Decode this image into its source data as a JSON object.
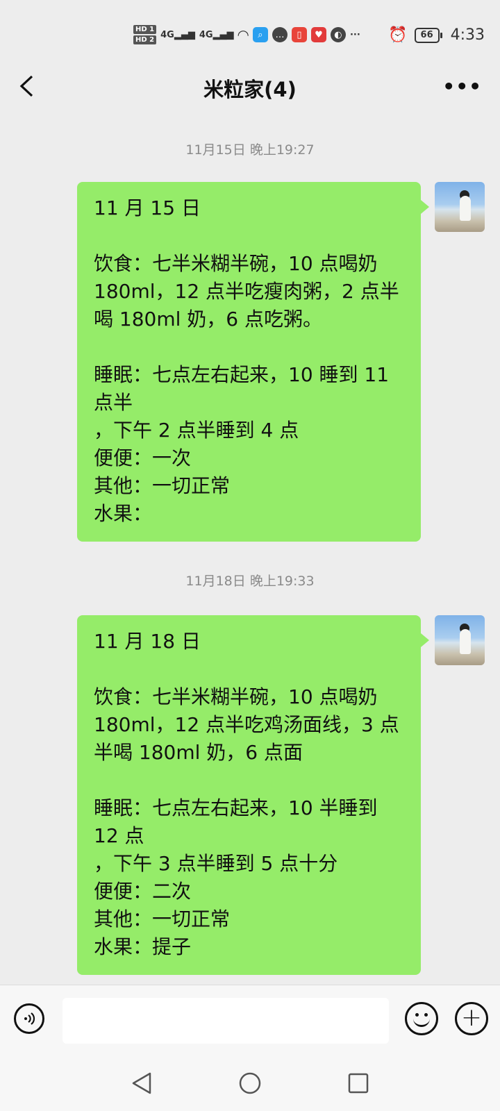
{
  "status_bar": {
    "hd1": "HD 1",
    "hd2": "HD 2",
    "signal1": "4G",
    "signal2": "4G",
    "battery": "66",
    "time": "4:33"
  },
  "header": {
    "title": "米粒家(4)"
  },
  "messages": [
    {
      "timestamp": "11月15日 晚上19:27",
      "lines": [
        "11 月 15 日",
        "",
        "饮食：七半米糊半碗，10 点喝奶 180ml，12 点半吃瘦肉粥，2 点半喝 180ml 奶，6 点吃粥。",
        "",
        "睡眠：七点左右起来，10 睡到 11 点半",
        "，下午 2 点半睡到 4 点",
        "便便：一次",
        "其他：一切正常",
        "水果："
      ]
    },
    {
      "timestamp": "11月18日 晚上19:33",
      "lines": [
        "11 月 18 日",
        "",
        "饮食：七半米糊半碗，10 点喝奶 180ml，12 点半吃鸡汤面线，3 点半喝 180ml 奶，6 点面",
        "",
        "睡眠：七点左右起来，10 半睡到 12 点",
        "，下午 3 点半睡到 5 点十分",
        "便便：二次",
        "其他：一切正常",
        "水果：提子"
      ]
    }
  ],
  "input": {
    "value": ""
  },
  "colors": {
    "bubble": "#95ec69",
    "background": "#ededed"
  }
}
